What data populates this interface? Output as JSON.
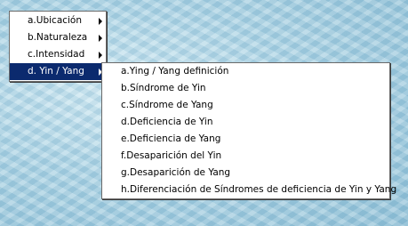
{
  "main_menu": {
    "items": [
      {
        "label": "a.Ubicación",
        "has_submenu": true
      },
      {
        "label": "b.Naturaleza",
        "has_submenu": true
      },
      {
        "label": "c.Intensidad",
        "has_submenu": true
      },
      {
        "label": "d. Yin / Yang",
        "has_submenu": true,
        "selected": true
      }
    ]
  },
  "sub_menu": {
    "items": [
      {
        "label": "a.Ying / Yang definición"
      },
      {
        "label": "b.Síndrome de Yin"
      },
      {
        "label": "c.Síndrome de Yang"
      },
      {
        "label": "d.Deficiencia de  Yin"
      },
      {
        "label": "e.Deficiencia de Yang"
      },
      {
        "label": "f.Desaparición del Yin"
      },
      {
        "label": "g.Desaparición de Yang"
      },
      {
        "label": "h.Diferenciación de Síndromes de deficiencia de Yin y Yang"
      }
    ]
  },
  "colors": {
    "selection_background": "#0b2a6e",
    "menu_background": "#ffffff"
  }
}
